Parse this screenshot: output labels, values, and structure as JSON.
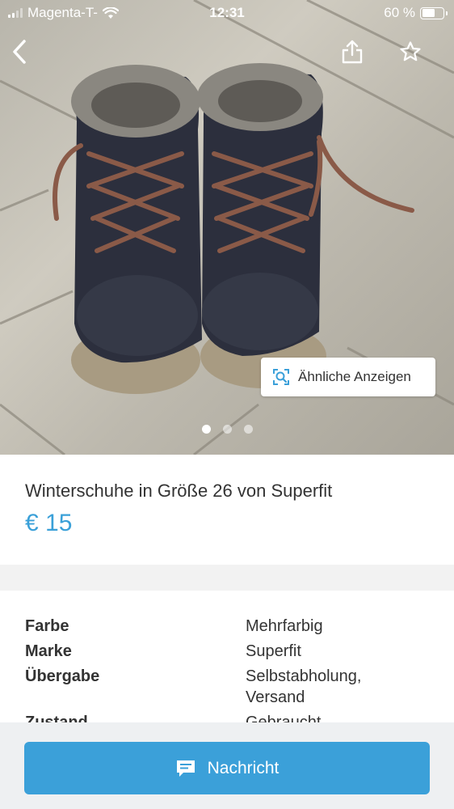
{
  "status_bar": {
    "carrier": "Magenta-T-",
    "time": "12:31",
    "battery": "60 %",
    "battery_level": 0.6
  },
  "nav": {
    "back_icon": "chevron-left-icon",
    "share_icon": "share-icon",
    "favorite_icon": "star-icon"
  },
  "gallery": {
    "similar_button_label": "Ähnliche Anzeigen",
    "image_count": 3,
    "active_index": 0
  },
  "listing": {
    "title": "Winterschuhe in Größe 26 von Superfit",
    "price": "€ 15"
  },
  "details": [
    {
      "key": "Farbe",
      "value": "Mehrfarbig"
    },
    {
      "key": "Marke",
      "value": "Superfit"
    },
    {
      "key": "Übergabe",
      "value": "Selbstabholung,\nVersand"
    },
    {
      "key": "Zustand",
      "value": "Gebraucht"
    }
  ],
  "actions": {
    "message_button_label": "Nachricht",
    "message_icon": "chat-icon"
  },
  "colors": {
    "accent": "#3ba0d9",
    "price": "#3aa0d8"
  }
}
